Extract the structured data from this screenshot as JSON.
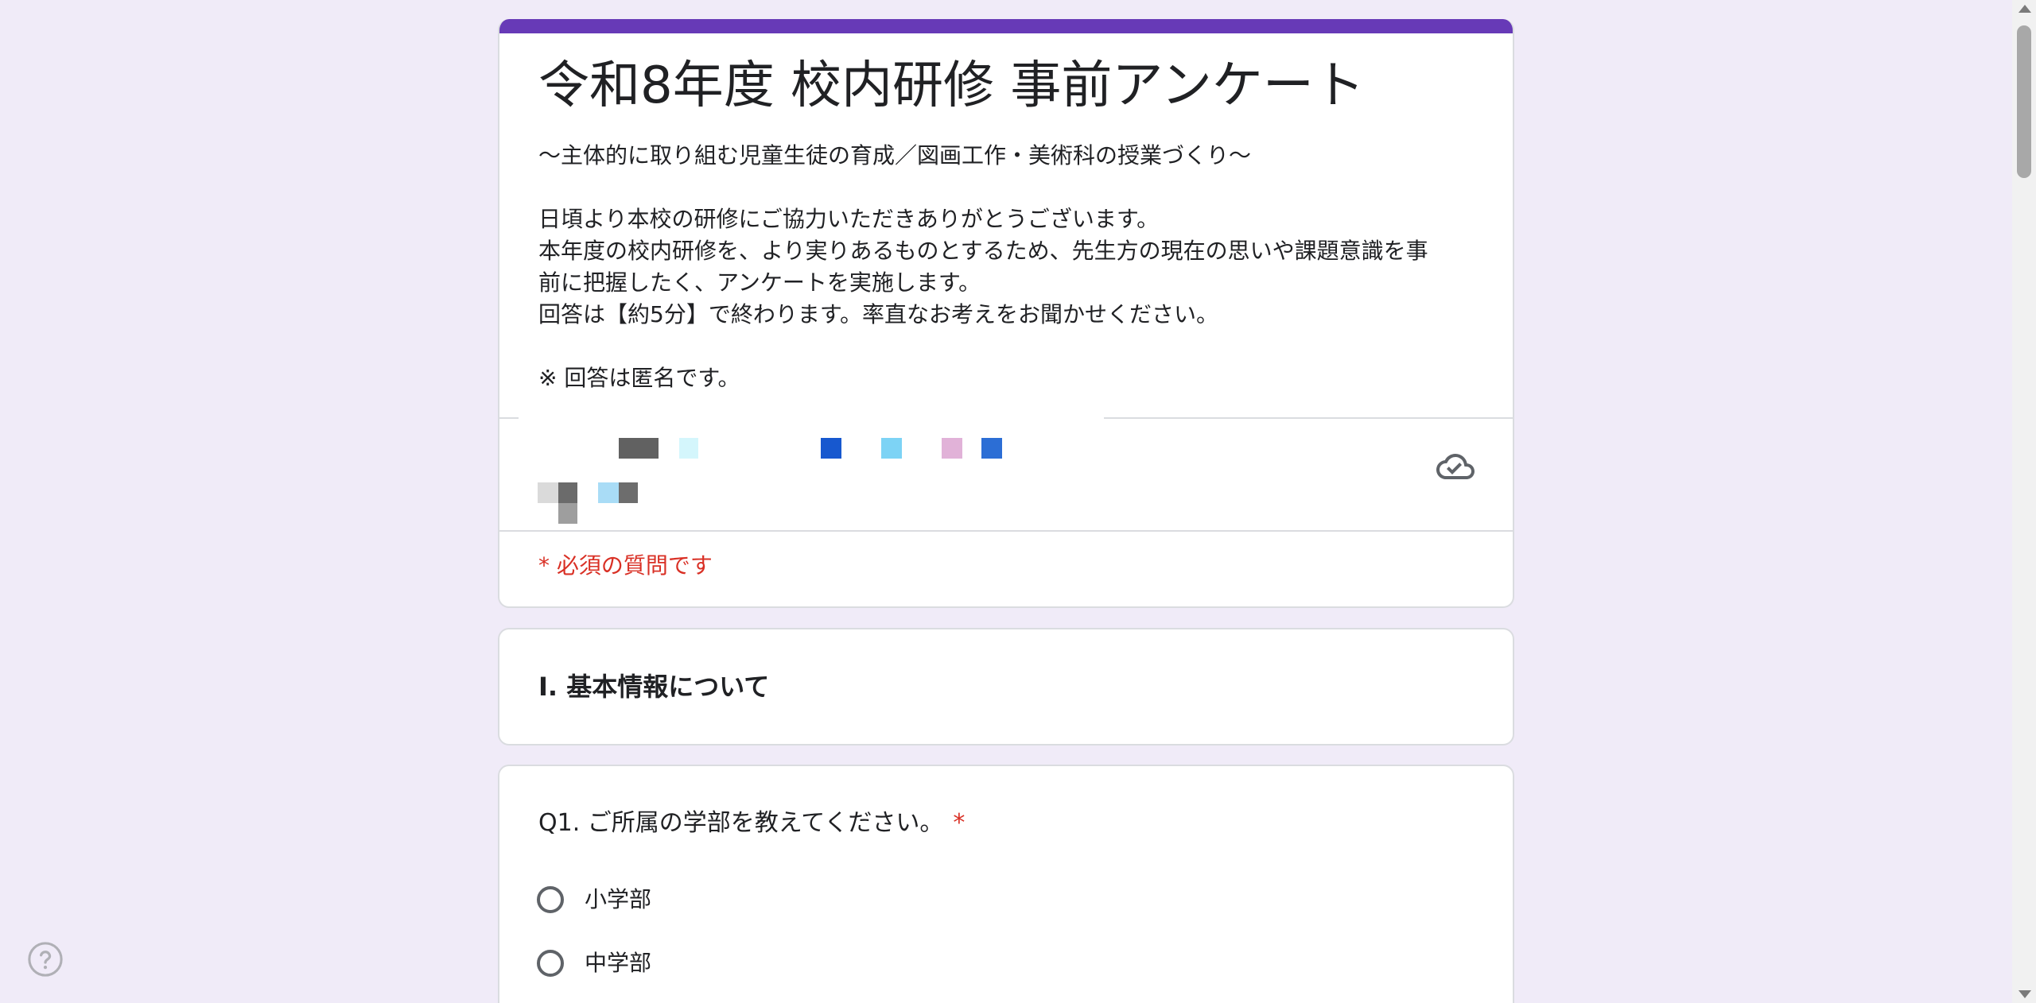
{
  "form": {
    "title": "令和8年度 校内研修 事前アンケート",
    "description": {
      "subtitle": "〜主体的に取り組む児童生徒の育成／図画工作・美術科の授業づくり〜",
      "lines": [
        "日頃より本校の研修にご協力いただきありがとうございます。",
        "本年度の校内研修を、より実りあるものとするため、先生方の現在の思いや課題意識を事",
        "前に把握したく、アンケートを実施します。",
        "回答は【約5分】で終わります。率直なお考えをお聞かせください。"
      ],
      "note": "※ 回答は匿名です。"
    },
    "required_note": "* 必須の質問です",
    "accent_color": "#673ab7",
    "background_color": "#f0ebf8",
    "required_color": "#d93025"
  },
  "account": {
    "cloud_icon": "cloud-saved-icon"
  },
  "section": {
    "title": "Ⅰ. 基本情報について"
  },
  "question1": {
    "title": "Q1. ご所属の学部を教えてください。",
    "required_mark": "*",
    "options": [
      {
        "label": "小学部"
      },
      {
        "label": "中学部"
      }
    ]
  },
  "help": {
    "icon": "help-icon"
  },
  "scrollbar": {
    "icon_up": "scroll-up-icon",
    "icon_down": "scroll-down-icon"
  }
}
